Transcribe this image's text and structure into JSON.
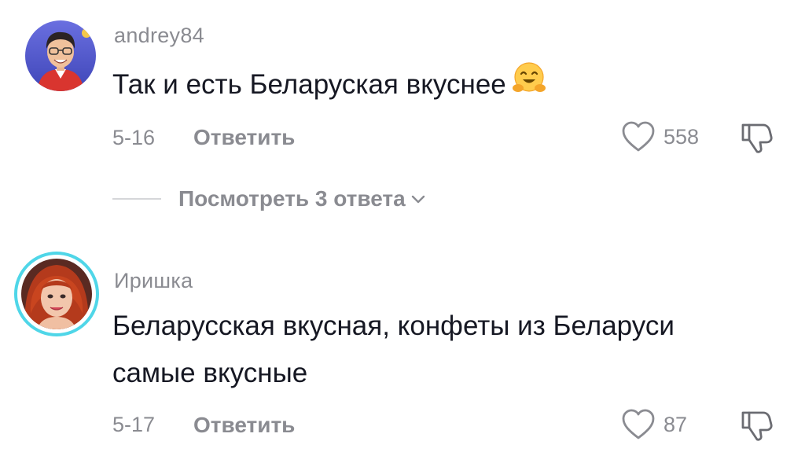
{
  "comments": [
    {
      "username": "andrey84",
      "text": "Так и есть Беларуская вкуснее",
      "emoji": "hugging-face-emoji",
      "date": "5-16",
      "reply_label": "Ответить",
      "likes": "558",
      "has_story_ring": false
    },
    {
      "username": "Иришка",
      "text_line1": "Беларусская вкусная, конфеты из Беларуси",
      "text_line2": "самые вкусные",
      "date": "5-17",
      "reply_label": "Ответить",
      "likes": "87",
      "has_story_ring": true
    }
  ],
  "view_replies": {
    "label": "Посмотреть 3 ответа"
  },
  "icons": {
    "like": "heart-outline-icon",
    "dislike": "thumbs-down-outline-icon",
    "expand": "chevron-down-icon"
  },
  "colors": {
    "primary_text": "#161823",
    "secondary_text": "#8a8b91",
    "story_ring": "#4fd6e8"
  }
}
